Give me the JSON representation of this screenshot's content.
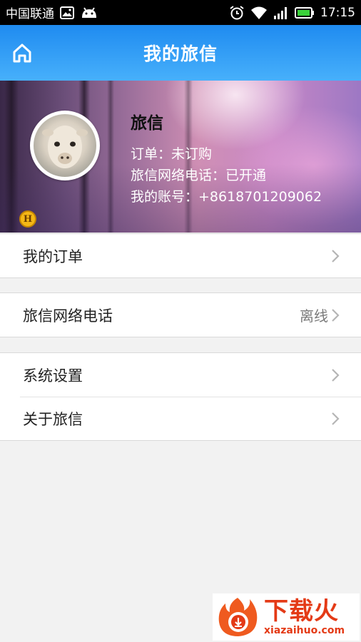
{
  "status_bar": {
    "carrier": "中国联通",
    "time": "17:15",
    "icons": [
      "image-icon",
      "android-icon",
      "alarm-icon",
      "wifi-icon",
      "signal-icon",
      "battery-icon"
    ]
  },
  "header": {
    "title": "我的旅信",
    "home_icon": "home-icon"
  },
  "profile": {
    "name": "旅信",
    "order_line": "订单：未订购",
    "phone_line": "旅信网络电话：已开通",
    "account_line": "我的账号：+8618701209062",
    "badge": "H"
  },
  "menu": {
    "groups": [
      [
        {
          "label": "我的订单",
          "value": ""
        }
      ],
      [
        {
          "label": "旅信网络电话",
          "value": "离线"
        }
      ],
      [
        {
          "label": "系统设置",
          "value": ""
        },
        {
          "label": "关于旅信",
          "value": ""
        }
      ]
    ]
  },
  "watermark": {
    "cn": "下载火",
    "url": "xiazaihuo.com"
  },
  "colors": {
    "header_top": "#1f8bf0",
    "header_bottom": "#47b0fb",
    "accent_watermark": "#e43a16",
    "battery": "#3ad13a"
  }
}
